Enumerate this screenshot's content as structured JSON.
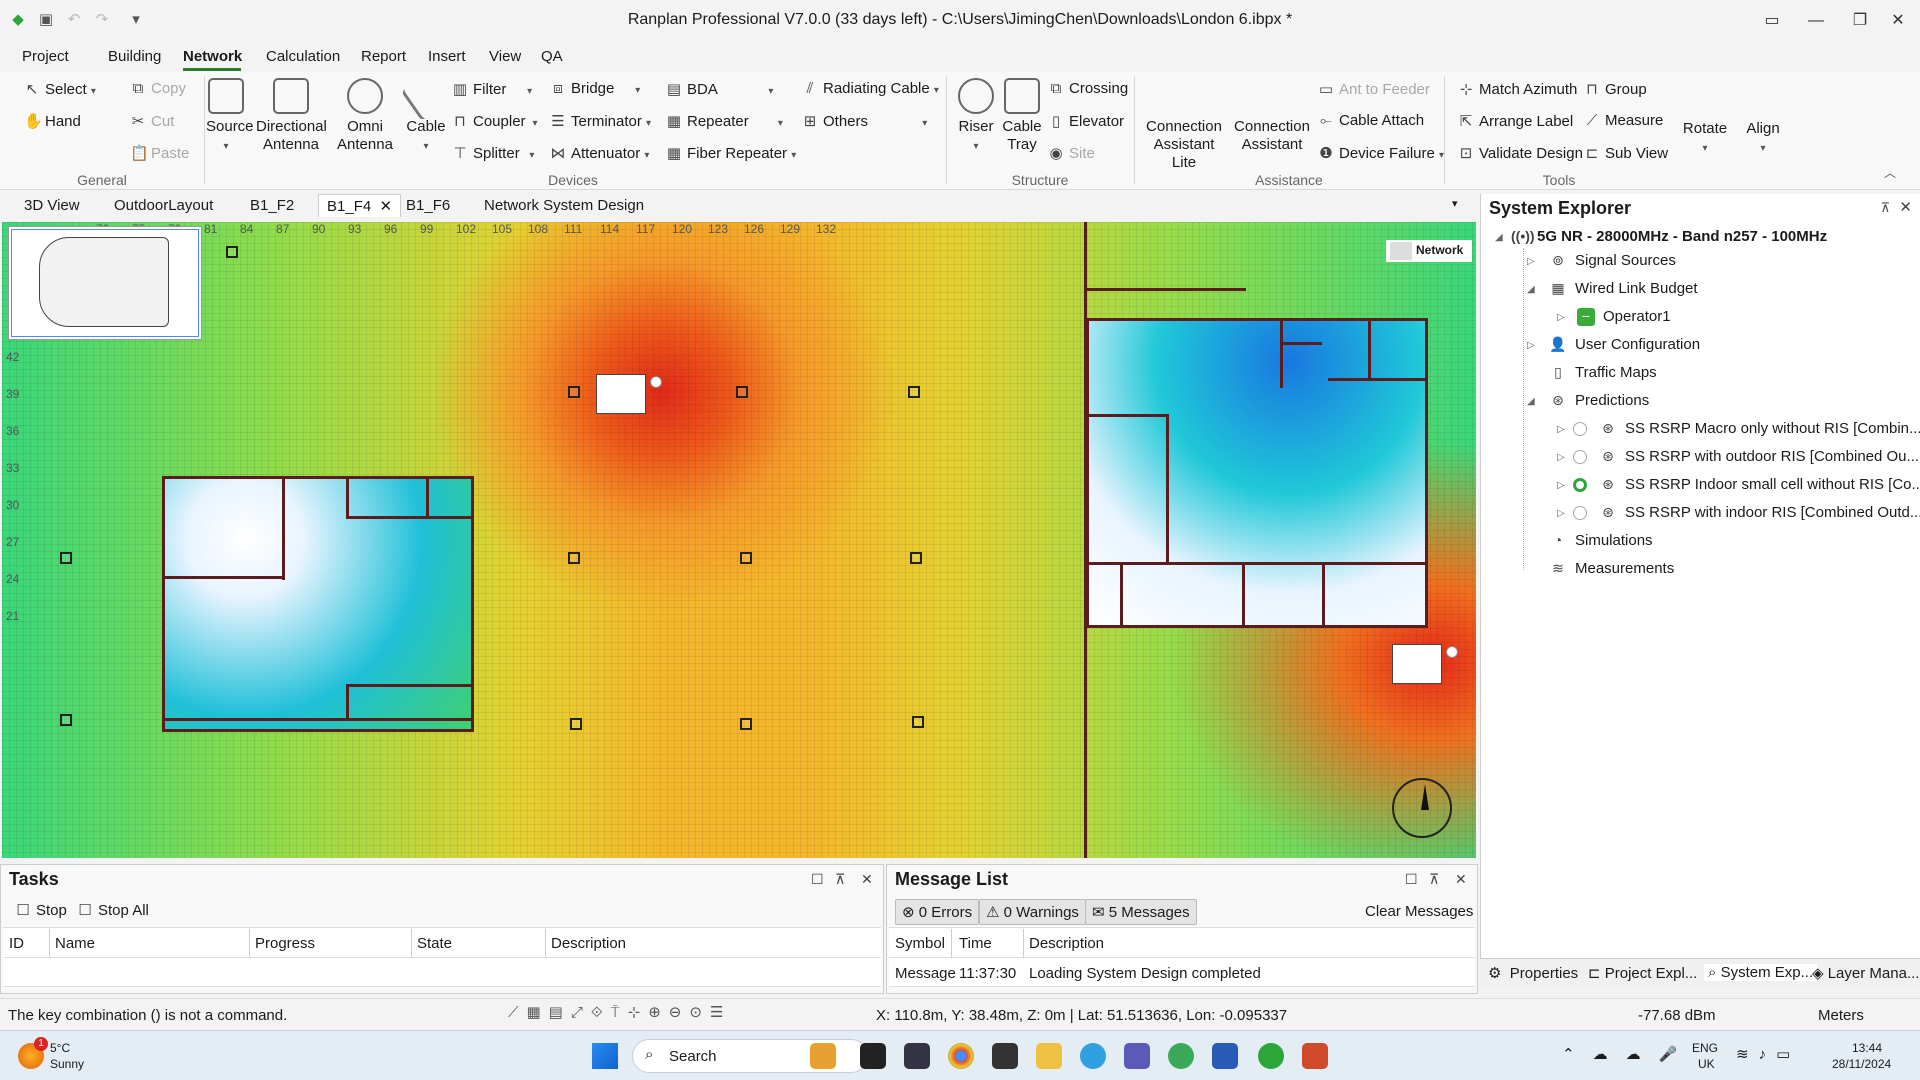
{
  "window": {
    "title": "Ranplan Professional V7.0.0 (33 days left) - C:\\Users\\JimingChen\\Downloads\\London 6.ibpx *"
  },
  "menu": [
    "Project",
    "Building",
    "Network",
    "Calculation",
    "Report",
    "Insert",
    "View",
    "QA"
  ],
  "ribbon": {
    "general": {
      "label": "General",
      "select": "Select",
      "hand": "Hand",
      "copy": "Copy",
      "cut": "Cut",
      "paste": "Paste"
    },
    "devices": {
      "label": "Devices",
      "source": "Source",
      "directional_antenna": "Directional Antenna",
      "omni_antenna": "Omni Antenna",
      "cable": "Cable",
      "filter": "Filter",
      "coupler": "Coupler",
      "splitter": "Splitter",
      "bridge": "Bridge",
      "terminator": "Terminator",
      "attenuator": "Attenuator",
      "bda": "BDA",
      "repeater": "Repeater",
      "fiber_repeater": "Fiber Repeater",
      "radiating_cable": "Radiating Cable",
      "others": "Others"
    },
    "structure": {
      "label": "Structure",
      "riser": "Riser",
      "cable_tray": "Cable Tray",
      "crossing": "Crossing",
      "elevator": "Elevator",
      "site": "Site"
    },
    "assistance": {
      "label": "Assistance",
      "conn_lite": "Connection Assistant Lite",
      "conn": "Connection Assistant",
      "ant_to_feeder": "Ant to Feeder",
      "cable_attach": "Cable Attach",
      "device_failure": "Device Failure"
    },
    "tools": {
      "label": "Tools",
      "match_azimuth": "Match Azimuth",
      "group": "Group",
      "arrange_label": "Arrange Label",
      "measure": "Measure",
      "validate_design": "Validate Design",
      "sub_view": "Sub View",
      "rotate": "Rotate",
      "align": "Align"
    }
  },
  "doc_tabs": [
    "3D View",
    "OutdoorLayout",
    "B1_F2",
    "B1_F4",
    "B1_F6",
    "Network System Design"
  ],
  "map": {
    "x_ticks": [
      "72",
      "75",
      "78",
      "81",
      "84",
      "87",
      "90",
      "93",
      "96",
      "99",
      "102",
      "105",
      "108",
      "111",
      "114",
      "117",
      "120",
      "123",
      "126",
      "129",
      "132"
    ],
    "y_ticks": [
      "42",
      "39",
      "36",
      "33",
      "30",
      "27",
      "24",
      "21"
    ],
    "network_label": "Network"
  },
  "explorer": {
    "title": "System Explorer",
    "root": "5G NR - 28000MHz - Band n257 - 100MHz",
    "signal_sources": "Signal Sources",
    "wired_link_budget": "Wired Link Budget",
    "operator1": "Operator1",
    "user_configuration": "User Configuration",
    "traffic_maps": "Traffic Maps",
    "predictions": "Predictions",
    "pred_items": [
      "SS RSRP Macro only without RIS [Combin...",
      "SS RSRP with outdoor RIS [Combined Ou...",
      "SS RSRP Indoor small cell without RIS [Co...",
      "SS RSRP with indoor RIS [Combined Outd..."
    ],
    "simulations": "Simulations",
    "measurements": "Measurements",
    "bottom_tabs": [
      "Properties",
      "Project Expl...",
      "System Exp...",
      "Layer Mana..."
    ]
  },
  "tasks": {
    "title": "Tasks",
    "stop": "Stop",
    "stop_all": "Stop All",
    "columns": [
      "ID",
      "Name",
      "Progress",
      "State",
      "Description"
    ]
  },
  "messages": {
    "title": "Message List",
    "errors": "0 Errors",
    "warnings": "0 Warnings",
    "messages": "5 Messages",
    "clear": "Clear Messages",
    "columns": [
      "Symbol",
      "Time",
      "Description"
    ],
    "row": {
      "symbol": "Message",
      "time": "11:37:30",
      "description": "Loading System Design completed"
    }
  },
  "status": {
    "left": "The key combination () is not a command.",
    "coords": "X: 110.8m, Y: 38.48m, Z: 0m | Lat: 51.513636, Lon: -0.095337",
    "signal": "-77.68 dBm",
    "units": "Meters"
  },
  "taskbar": {
    "weather_temp": "5°C",
    "weather_desc": "Sunny",
    "search": "Search",
    "lang1": "ENG",
    "lang2": "UK",
    "time": "13:44",
    "date": "28/11/2024",
    "badge": "1"
  }
}
